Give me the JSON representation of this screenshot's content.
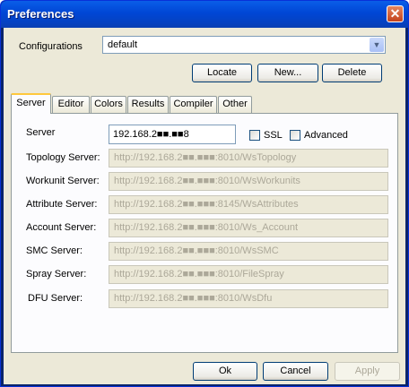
{
  "window": {
    "title": "Preferences",
    "close_symbol": "✕"
  },
  "configurations": {
    "label": "Configurations",
    "selected": "default",
    "buttons": {
      "locate": "Locate",
      "new": "New...",
      "delete": "Delete"
    }
  },
  "tabs": [
    "Server",
    "Editor",
    "Colors",
    "Results",
    "Compiler",
    "Other"
  ],
  "server_tab": {
    "server_label": "Server",
    "server_value": "192.168.2■■.■■8",
    "ssl_label": "SSL",
    "ssl_checked": false,
    "advanced_label": "Advanced",
    "advanced_checked": false,
    "fields": [
      {
        "label": "Topology Server:",
        "value": "http://192.168.2■■.■■■:8010/WsTopology"
      },
      {
        "label": "Workunit Server:",
        "value": "http://192.168.2■■.■■■:8010/WsWorkunits"
      },
      {
        "label": "Attribute Server:",
        "value": "http://192.168.2■■.■■■:8145/WsAttributes"
      },
      {
        "label": "Account Server:",
        "value": "http://192.168.2■■.■■■:8010/Ws_Account"
      },
      {
        "label": "SMC Server:",
        "value": "http://192.168.2■■.■■■:8010/WsSMC"
      },
      {
        "label": "Spray Server:",
        "value": "http://192.168.2■■.■■■:8010/FileSpray"
      },
      {
        "label": "DFU Server:",
        "value": "http://192.168.2■■.■■■:8010/WsDfu"
      }
    ]
  },
  "footer": {
    "ok": "Ok",
    "cancel": "Cancel",
    "apply": "Apply"
  }
}
